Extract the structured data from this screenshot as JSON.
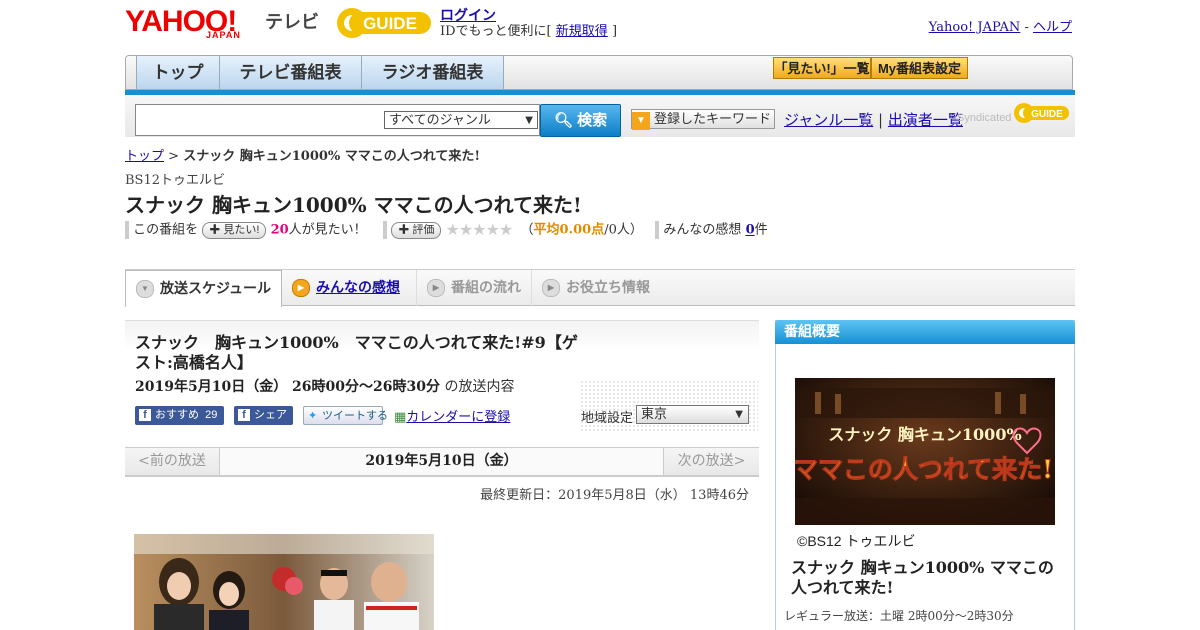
{
  "header": {
    "yahoo_logo": "YAHOO!",
    "japan": "JAPAN",
    "tv": "テレビ",
    "gguide_logo": "GUIDE",
    "login": "ログイン",
    "id_prefix": "IDでもっと便利に[",
    "signup": "新規取得",
    "id_suffix": "]",
    "yahoo_japan_link": "Yahoo! JAPAN",
    "dash": "-",
    "help_link": "ヘルプ"
  },
  "nav": {
    "tabs": [
      "トップ",
      "テレビ番組表",
      "ラジオ番組表"
    ],
    "want_list": "「見たい!」一覧",
    "my_schedule": "My番組表設定"
  },
  "search": {
    "placeholder": "",
    "genre_select": "すべてのジャンル",
    "search_button": "検索",
    "keyword_button": "登録したキーワード",
    "genre_list": "ジャンル一覧",
    "link_sep": "|",
    "performer_list": "出演者一覧",
    "syndicated": "Syndicated"
  },
  "breadcrumb": {
    "top": "トップ",
    "sep": ">",
    "current": "スナック 胸キュン1000% ママこの人つれて来た!"
  },
  "program": {
    "channel": "BS12トゥエルビ",
    "title": "スナック 胸キュン1000% ママこの人つれて来た!",
    "this_program": "この番組を",
    "want_button": "見たい!",
    "want_count": "20",
    "want_suffix": "人が見たい！",
    "rate_button": "評価",
    "stars": "★★★★★",
    "avg_open": "（",
    "avg_label": "平均0.00点",
    "avg_people": "/0人）",
    "comments_label": "みんなの感想",
    "comments_count": "0",
    "comments_suffix": "件"
  },
  "tabs": {
    "schedule": "放送スケジュール",
    "comments": "みんなの感想",
    "flow": "番組の流れ",
    "info": "お役立ち情報"
  },
  "episode": {
    "title": "スナック　胸キュン1000%　ママこの人つれて来た!#9【ゲスト:高橋名人】",
    "datetime": "2019年5月10日（金） 26時00分～26時30分",
    "datetime_suffix": "の放送内容",
    "recommend": "おすすめ",
    "recommend_count": "29",
    "share": "シェア",
    "tweet": "ツイートする",
    "calendar": "カレンダーに登録",
    "region_label": "地域設定",
    "region_value": "東京"
  },
  "date_nav": {
    "prev": "<前の放送",
    "current": "2019年5月10日（金）",
    "next": "次の放送>"
  },
  "updated": "最終更新日：2019年5月8日（水） 13時46分",
  "sidebar": {
    "heading": "番組概要",
    "image_line1": "スナック 胸キュン1000%",
    "image_line2": "ママこの人つれて来た!",
    "copyright": "©BS12 トゥエルビ",
    "title": "スナック 胸キュン1000% ママこの人つれて来た!",
    "regular": "レギュラー放送：土曜 2時00分～2時30分"
  },
  "colors": {
    "accent_blue": "#1a8fd0",
    "gguide_yellow": "#f2c200",
    "want_pink": "#e4007f",
    "avg_orange": "#e08a00"
  }
}
